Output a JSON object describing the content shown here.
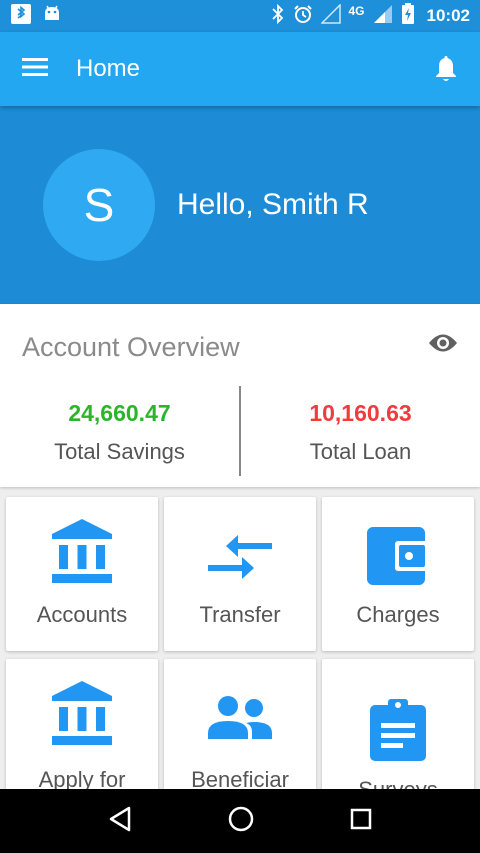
{
  "status_bar": {
    "network": "4G",
    "time": "10:02"
  },
  "app_bar": {
    "title": "Home"
  },
  "profile": {
    "initial": "S",
    "greeting": "Hello, Smith R"
  },
  "overview": {
    "title": "Account Overview",
    "savings_value": "24,660.47",
    "savings_label": "Total Savings",
    "loan_value": "10,160.63",
    "loan_label": "Total Loan"
  },
  "tiles": [
    {
      "label": "Accounts",
      "icon": "bank-icon"
    },
    {
      "label": "Transfer",
      "icon": "transfer-icon"
    },
    {
      "label": "Charges",
      "icon": "wallet-icon"
    },
    {
      "label": "Apply for",
      "icon": "bank-icon"
    },
    {
      "label": "Beneficiar",
      "icon": "people-icon"
    },
    {
      "label": "Surveys",
      "icon": "clipboard-icon"
    }
  ],
  "colors": {
    "primary": "#22a7f0",
    "primary_dark": "#1e8bd6",
    "savings": "#2bb52b",
    "loan": "#f03c3c",
    "icon": "#2196f3"
  }
}
